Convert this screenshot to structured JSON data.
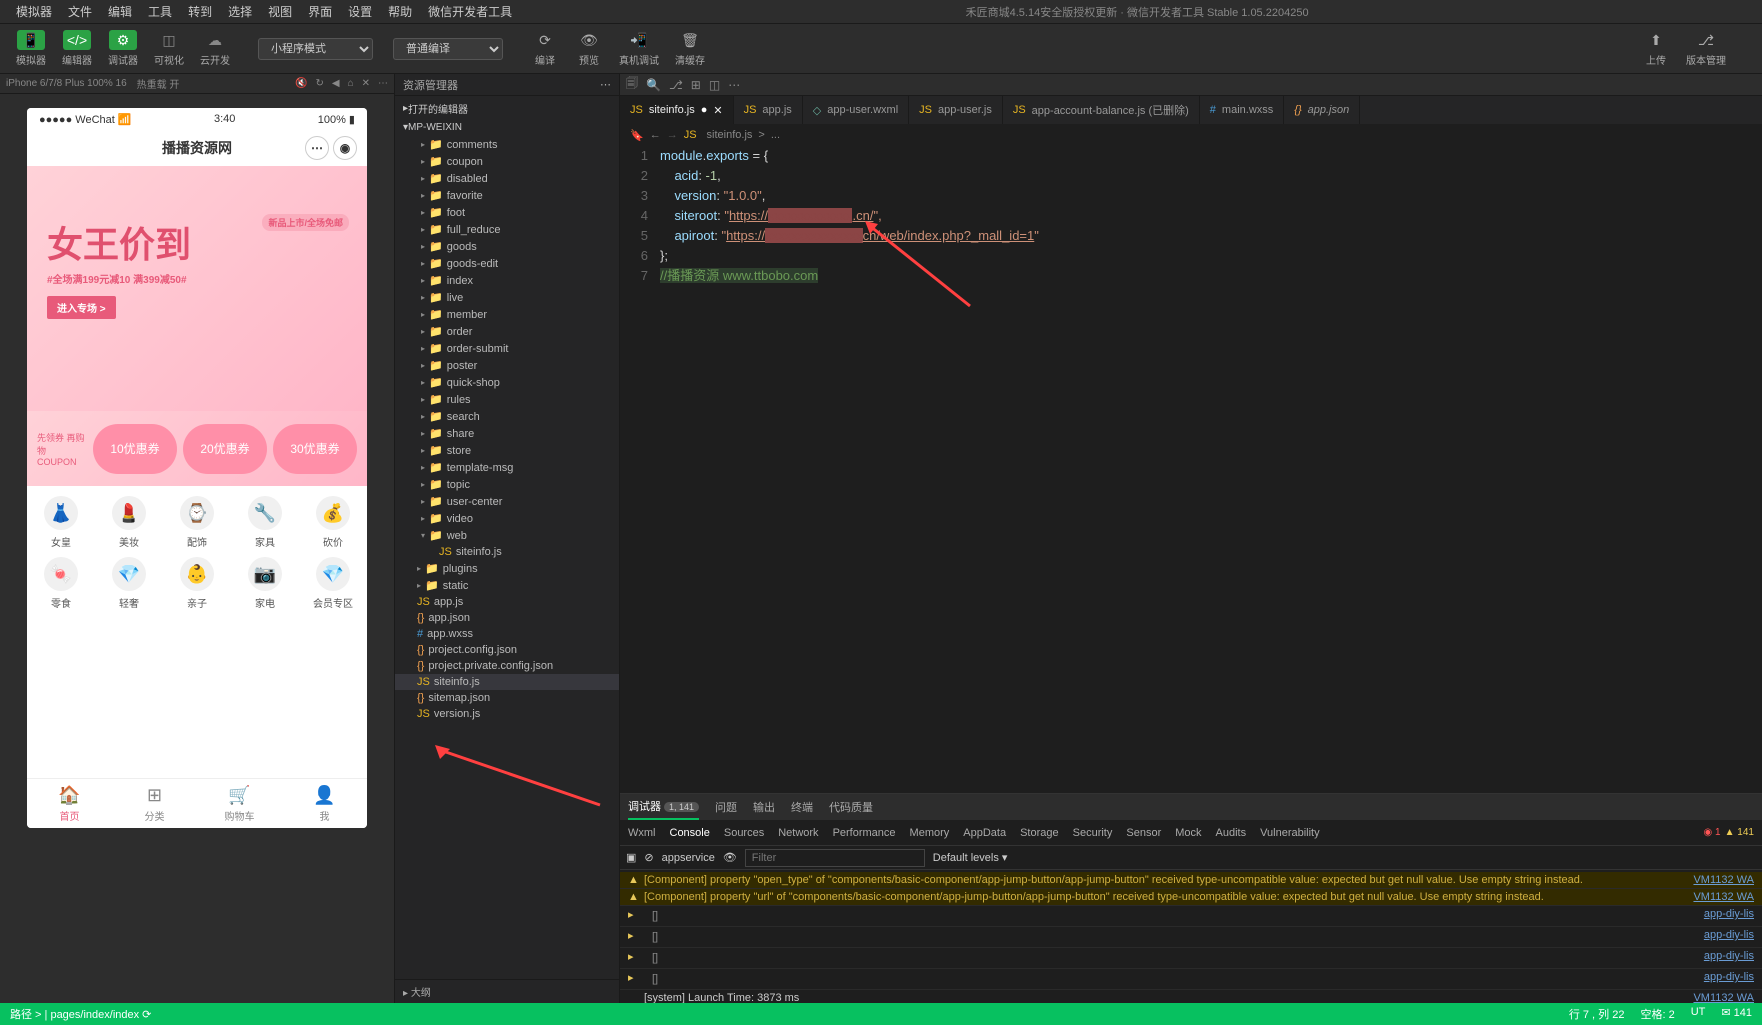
{
  "window_title": "禾匠商城4.5.14安全版授权更新 · 微信开发者工具 Stable 1.05.2204250",
  "menu": [
    "模拟器",
    "文件",
    "编辑",
    "工具",
    "转到",
    "选择",
    "视图",
    "界面",
    "设置",
    "帮助",
    "微信开发者工具"
  ],
  "toolbar_buttons": {
    "sim": "模拟器",
    "editor": "编辑器",
    "debugger": "调试器",
    "visual": "可视化",
    "cloud": "云开发"
  },
  "toolbar_center": [
    "编译",
    "预览",
    "真机调试",
    "清缓存"
  ],
  "toolbar_right": {
    "upload": "上传",
    "version": "版本管理"
  },
  "select1": "小程序模式",
  "select2": "普通编译",
  "sim_top": {
    "device": "iPhone 6/7/8 Plus 100% 16",
    "reload": "热重载 开"
  },
  "phone": {
    "carrier": "WeChat",
    "time": "3:40",
    "battery": "100%",
    "nav_title": "播播资源网",
    "banner_title": "女王价到",
    "banner_sub": "#全场满199元减10 满399减50#",
    "banner_sub2": "新品上市/全场免邮",
    "banner_btn": "进入专场 >",
    "coupon_label": "先领券 再购物 COUPON",
    "coupons": [
      "10优惠券",
      "20优惠券",
      "30优惠券"
    ],
    "cats": [
      {
        "label": "女皇",
        "ic": "👗"
      },
      {
        "label": "美妆",
        "ic": "💄"
      },
      {
        "label": "配饰",
        "ic": "⌚"
      },
      {
        "label": "家具",
        "ic": "🔧"
      },
      {
        "label": "砍价",
        "ic": "💰"
      },
      {
        "label": "零食",
        "ic": "🍬"
      },
      {
        "label": "轻奢",
        "ic": "💎"
      },
      {
        "label": "亲子",
        "ic": "👶"
      },
      {
        "label": "家电",
        "ic": "📷"
      },
      {
        "label": "会员专区",
        "ic": "💎"
      }
    ],
    "tabs": [
      {
        "label": "首页",
        "ic": "🏠"
      },
      {
        "label": "分类",
        "ic": "⊞"
      },
      {
        "label": "购物车",
        "ic": "🛒"
      },
      {
        "label": "我",
        "ic": "👤"
      }
    ]
  },
  "explorer": {
    "title": "资源管理器",
    "sections": [
      {
        "label": "打开的编辑器",
        "open": false
      },
      {
        "label": "MP-WEIXIN",
        "open": true
      }
    ],
    "folders": [
      "comments",
      "coupon",
      "disabled",
      "favorite",
      "foot",
      "full_reduce",
      "goods",
      "goods-edit",
      "index",
      "live",
      "member",
      "order",
      "order-submit",
      "poster",
      "quick-shop",
      "rules",
      "search",
      "share",
      "store",
      "template-msg",
      "topic",
      "user-center",
      "video",
      "web"
    ],
    "siteinfo_under_web": "siteinfo.js",
    "root_folders": [
      "plugins",
      "static"
    ],
    "root_files": [
      {
        "name": "app.js",
        "ic": "js"
      },
      {
        "name": "app.json",
        "ic": "json"
      },
      {
        "name": "app.wxss",
        "ic": "wxss"
      },
      {
        "name": "project.config.json",
        "ic": "json"
      },
      {
        "name": "project.private.config.json",
        "ic": "json"
      },
      {
        "name": "siteinfo.js",
        "ic": "js",
        "sel": true
      },
      {
        "name": "sitemap.json",
        "ic": "json"
      },
      {
        "name": "version.js",
        "ic": "js"
      }
    ],
    "outline": "大纲"
  },
  "editor_tabs": [
    {
      "name": "siteinfo.js",
      "active": true,
      "dirty": true,
      "ic": "js"
    },
    {
      "name": "app.js",
      "ic": "js"
    },
    {
      "name": "app-user.wxml",
      "ic": "wxml"
    },
    {
      "name": "app-user.js",
      "ic": "js"
    },
    {
      "name": "app-account-balance.js (已删除)",
      "ic": "js"
    },
    {
      "name": "main.wxss",
      "ic": "wxss"
    },
    {
      "name": "app.json",
      "ic": "json",
      "italic": true
    }
  ],
  "breadcrumb": [
    "siteinfo.js",
    "..."
  ],
  "code": {
    "l1": {
      "a": "module",
      "b": ".",
      "c": "exports",
      "d": " = {"
    },
    "l2": {
      "a": "acid",
      "b": ": ",
      "c": "-1",
      "d": ","
    },
    "l3": {
      "a": "version",
      "b": ": ",
      "c": "\"1.0.0\"",
      "d": ","
    },
    "l4": {
      "a": "siteroot",
      "b": ": ",
      "c": "\"",
      "d": "https://",
      "e": ".cn/",
      "f": "\","
    },
    "l5": {
      "a": "apiroot",
      "b": ": ",
      "c": "\"",
      "d": "https://",
      "e": "cn/web/index.php?_mall_id=1",
      "f": "\""
    },
    "l6": "};",
    "l7": "//播播资源 www.ttbobo.com"
  },
  "bottom": {
    "tabs1": [
      {
        "label": "调试器",
        "badge": "1, 141"
      },
      {
        "label": "问题"
      },
      {
        "label": "输出"
      },
      {
        "label": "终端"
      },
      {
        "label": "代码质量"
      }
    ],
    "tabs2": [
      "Wxml",
      "Console",
      "Sources",
      "Network",
      "Performance",
      "Memory",
      "AppData",
      "Storage",
      "Security",
      "Sensor",
      "Mock",
      "Audits",
      "Vulnerability"
    ],
    "warn": {
      "err": "◉ 1",
      "warn": "▲ 141"
    },
    "filter_placeholder": "Filter",
    "levels": "Default levels ▾",
    "top": "appservice",
    "lines": [
      {
        "type": "warn",
        "msg": "[Component] property \"open_type\" of \"components/basic-component/app-jump-button/app-jump-button\" received type-uncompatible value: expected <String> but get null value. Use empty string instead.",
        "src": "VM1132 WA"
      },
      {
        "type": "warn",
        "msg": "[Component] property \"url\" of \"components/basic-component/app-jump-button/app-jump-button\" received type-uncompatible value: expected <String> but get null value. Use empty string instead.",
        "src": "VM1132 WA"
      },
      {
        "type": "expand",
        "msg": "[]",
        "src": "app-diy-lis"
      },
      {
        "type": "expand",
        "msg": "[]",
        "src": "app-diy-lis"
      },
      {
        "type": "expand",
        "msg": "[]",
        "src": "app-diy-lis"
      },
      {
        "type": "expand",
        "msg": "[]",
        "src": "app-diy-lis"
      },
      {
        "type": "plain",
        "msg": "[system] Launch Time: 3873 ms",
        "src": "VM1132 WA"
      }
    ]
  },
  "statusbar": {
    "left": "路径 > | pages/index/index ⟳",
    "line": "行 7 , 列 22",
    "space": "空格: 2",
    "enc": "UT"
  }
}
